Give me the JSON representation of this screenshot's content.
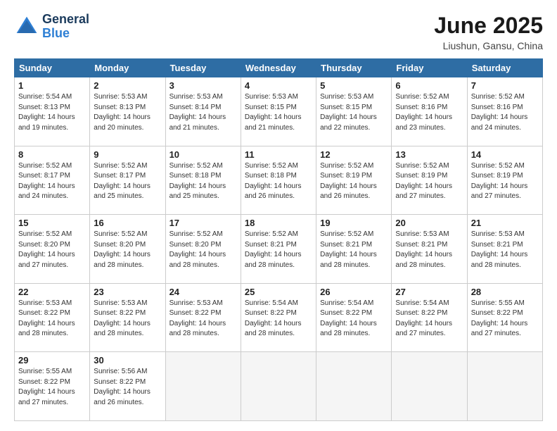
{
  "logo": {
    "general": "General",
    "blue": "Blue"
  },
  "title": "June 2025",
  "subtitle": "Liushun, Gansu, China",
  "days_of_week": [
    "Sunday",
    "Monday",
    "Tuesday",
    "Wednesday",
    "Thursday",
    "Friday",
    "Saturday"
  ],
  "weeks": [
    [
      {
        "num": "1",
        "sunrise": "5:54 AM",
        "sunset": "8:13 PM",
        "daylight": "14 hours and 19 minutes."
      },
      {
        "num": "2",
        "sunrise": "5:53 AM",
        "sunset": "8:13 PM",
        "daylight": "14 hours and 20 minutes."
      },
      {
        "num": "3",
        "sunrise": "5:53 AM",
        "sunset": "8:14 PM",
        "daylight": "14 hours and 21 minutes."
      },
      {
        "num": "4",
        "sunrise": "5:53 AM",
        "sunset": "8:15 PM",
        "daylight": "14 hours and 21 minutes."
      },
      {
        "num": "5",
        "sunrise": "5:53 AM",
        "sunset": "8:15 PM",
        "daylight": "14 hours and 22 minutes."
      },
      {
        "num": "6",
        "sunrise": "5:52 AM",
        "sunset": "8:16 PM",
        "daylight": "14 hours and 23 minutes."
      },
      {
        "num": "7",
        "sunrise": "5:52 AM",
        "sunset": "8:16 PM",
        "daylight": "14 hours and 24 minutes."
      }
    ],
    [
      {
        "num": "8",
        "sunrise": "5:52 AM",
        "sunset": "8:17 PM",
        "daylight": "14 hours and 24 minutes."
      },
      {
        "num": "9",
        "sunrise": "5:52 AM",
        "sunset": "8:17 PM",
        "daylight": "14 hours and 25 minutes."
      },
      {
        "num": "10",
        "sunrise": "5:52 AM",
        "sunset": "8:18 PM",
        "daylight": "14 hours and 25 minutes."
      },
      {
        "num": "11",
        "sunrise": "5:52 AM",
        "sunset": "8:18 PM",
        "daylight": "14 hours and 26 minutes."
      },
      {
        "num": "12",
        "sunrise": "5:52 AM",
        "sunset": "8:19 PM",
        "daylight": "14 hours and 26 minutes."
      },
      {
        "num": "13",
        "sunrise": "5:52 AM",
        "sunset": "8:19 PM",
        "daylight": "14 hours and 27 minutes."
      },
      {
        "num": "14",
        "sunrise": "5:52 AM",
        "sunset": "8:19 PM",
        "daylight": "14 hours and 27 minutes."
      }
    ],
    [
      {
        "num": "15",
        "sunrise": "5:52 AM",
        "sunset": "8:20 PM",
        "daylight": "14 hours and 27 minutes."
      },
      {
        "num": "16",
        "sunrise": "5:52 AM",
        "sunset": "8:20 PM",
        "daylight": "14 hours and 28 minutes."
      },
      {
        "num": "17",
        "sunrise": "5:52 AM",
        "sunset": "8:20 PM",
        "daylight": "14 hours and 28 minutes."
      },
      {
        "num": "18",
        "sunrise": "5:52 AM",
        "sunset": "8:21 PM",
        "daylight": "14 hours and 28 minutes."
      },
      {
        "num": "19",
        "sunrise": "5:52 AM",
        "sunset": "8:21 PM",
        "daylight": "14 hours and 28 minutes."
      },
      {
        "num": "20",
        "sunrise": "5:53 AM",
        "sunset": "8:21 PM",
        "daylight": "14 hours and 28 minutes."
      },
      {
        "num": "21",
        "sunrise": "5:53 AM",
        "sunset": "8:21 PM",
        "daylight": "14 hours and 28 minutes."
      }
    ],
    [
      {
        "num": "22",
        "sunrise": "5:53 AM",
        "sunset": "8:22 PM",
        "daylight": "14 hours and 28 minutes."
      },
      {
        "num": "23",
        "sunrise": "5:53 AM",
        "sunset": "8:22 PM",
        "daylight": "14 hours and 28 minutes."
      },
      {
        "num": "24",
        "sunrise": "5:53 AM",
        "sunset": "8:22 PM",
        "daylight": "14 hours and 28 minutes."
      },
      {
        "num": "25",
        "sunrise": "5:54 AM",
        "sunset": "8:22 PM",
        "daylight": "14 hours and 28 minutes."
      },
      {
        "num": "26",
        "sunrise": "5:54 AM",
        "sunset": "8:22 PM",
        "daylight": "14 hours and 28 minutes."
      },
      {
        "num": "27",
        "sunrise": "5:54 AM",
        "sunset": "8:22 PM",
        "daylight": "14 hours and 27 minutes."
      },
      {
        "num": "28",
        "sunrise": "5:55 AM",
        "sunset": "8:22 PM",
        "daylight": "14 hours and 27 minutes."
      }
    ],
    [
      {
        "num": "29",
        "sunrise": "5:55 AM",
        "sunset": "8:22 PM",
        "daylight": "14 hours and 27 minutes."
      },
      {
        "num": "30",
        "sunrise": "5:56 AM",
        "sunset": "8:22 PM",
        "daylight": "14 hours and 26 minutes."
      },
      null,
      null,
      null,
      null,
      null
    ]
  ]
}
